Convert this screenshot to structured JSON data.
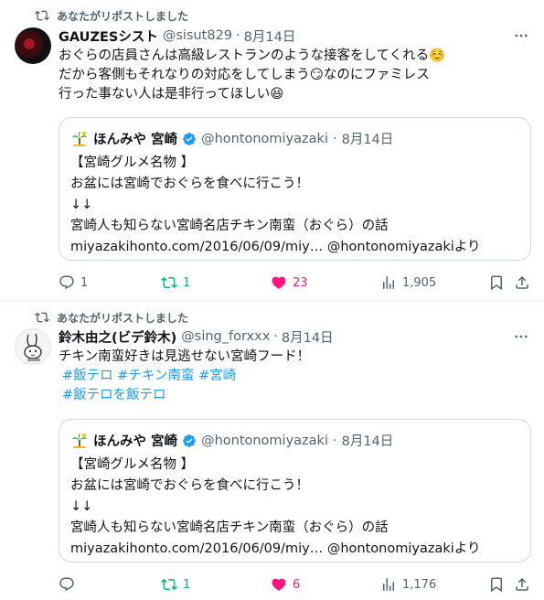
{
  "posts": [
    {
      "repost_label": "あなたがリポストしました",
      "author_name": "GAUZESシスト",
      "handle": "@sisut829",
      "dot": "·",
      "date": "8月14日",
      "lines": [
        "おぐらの店員さんは高級レストランのような接客をしてくれる☺️",
        "だから客側もそれなりの対応をしてしまう😏なのにファミレス",
        "行った事ない人は是非行ってほしい😆"
      ],
      "quote": {
        "name": "ほんみや 宮崎",
        "handle": "@hontonomiyazaki",
        "dot": "·",
        "date": "8月14日",
        "lines": [
          "【宮崎グルメ名物 】",
          "お盆には宮崎でおぐらを食べに行こう！",
          "↓↓",
          "宮崎人も知らない宮崎名店チキン南蛮（おぐら）の話",
          "miyazakihonto.com/2016/06/09/miy…  @hontonomiyazakiより"
        ]
      },
      "stats": {
        "replies": "1",
        "reposts": "1",
        "likes": "23",
        "views": "1,905"
      }
    },
    {
      "repost_label": "あなたがリポストしました",
      "author_name": "鈴木由之(ビデ鈴木)",
      "handle": "@sing_forxxx",
      "dot": "·",
      "date": "8月14日",
      "line1": "チキン南蛮好きは見逃せない宮崎フード！",
      "hashtags_row1": [
        "#飯テロ",
        "#チキン南蛮",
        "#宮崎"
      ],
      "hashtags_row2": [
        "#飯テロを飯テロ"
      ],
      "quote": {
        "name": "ほんみや 宮崎",
        "handle": "@hontonomiyazaki",
        "dot": "·",
        "date": "8月14日",
        "lines": [
          "【宮崎グルメ名物 】",
          "お盆には宮崎でおぐらを食べに行こう！",
          "↓↓",
          "宮崎人も知らない宮崎名店チキン南蛮（おぐら）の話",
          "miyazakihonto.com/2016/06/09/miy…  @hontonomiyazakiより"
        ]
      },
      "stats": {
        "replies": "",
        "reposts": "1",
        "likes": "6",
        "views": "1,176"
      }
    }
  ],
  "colors": {
    "text": "#0f1419",
    "muted": "#536471",
    "link": "#1d9bf0",
    "repost_green": "#00ba7c",
    "like_pink": "#f91880",
    "verified_blue": "#1d9bf0",
    "border": "#cfd9de"
  },
  "icons": [
    "repost-icon",
    "more-icon",
    "verified-badge-icon",
    "reply-icon",
    "like-icon",
    "views-icon",
    "bookmark-icon",
    "share-icon"
  ]
}
